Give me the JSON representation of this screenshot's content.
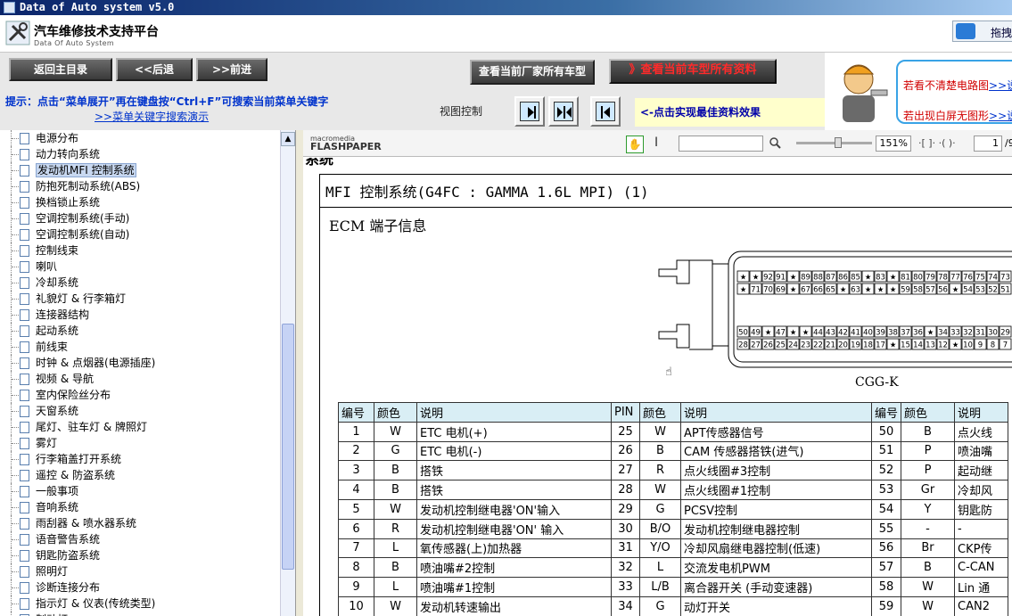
{
  "window": {
    "title": "Data of Auto system v5.0"
  },
  "logo": {
    "main": "汽车维修技术支持平台",
    "sub": "Data Of Auto System"
  },
  "search_widget": {
    "label": "拖拽"
  },
  "nav": {
    "home": "返回主目录",
    "back": "<<后退",
    "forward": ">>前进",
    "all_models": "查看当前厂家所有车型",
    "all_data": "》查看当前车型所有资料"
  },
  "hint": {
    "text": "提示：点击“菜单展开”再在键盘按“Ctrl+F”可搜索当前菜单关键字",
    "link": ">>菜单关键字搜索演示",
    "view_control": "视图控制",
    "best_effect": "<-点击实现最佳资料效果"
  },
  "notices": {
    "line1": "若看不清楚电路图",
    "line1_link": ">>说",
    "line2": "若出现白屏无图形",
    "line2_link": ">>说"
  },
  "sidebar": {
    "items": [
      "电源分布",
      "动力转向系统",
      "发动机MFI 控制系统",
      "防抱死制动系统(ABS)",
      "换档锁止系统",
      "空调控制系统(手动)",
      "空调控制系统(自动)",
      "控制线束",
      "喇叭",
      "冷却系统",
      "礼貌灯 & 行李箱灯",
      "连接器结构",
      "起动系统",
      "前线束",
      "时钟 & 点烟器(电源插座)",
      "视频 & 导航",
      "室内保险丝分布",
      "天窗系统",
      "尾灯、驻车灯 & 牌照灯",
      "雾灯",
      "行李箱盖打开系统",
      "遥控 & 防盗系统",
      "一般事项",
      "音响系统",
      "雨刮器 & 喷水器系统",
      "语音警告系统",
      "钥匙防盗系统",
      "照明灯",
      "诊断连接分布",
      "指示灯 & 仪表(传统类型)",
      "制动灯"
    ],
    "selected_index": 2
  },
  "viewer": {
    "brand_top": "macromedia",
    "brand_bottom": "FLASHPAPER",
    "zoom": "151%",
    "page": "1",
    "page_total": "/9"
  },
  "document": {
    "prev_tail": "系统",
    "title": "MFI 控制系统(G4FC : GAMMA 1.6L MPI) (1)",
    "heading": "ECM  端子信息",
    "connector_label": "CGG-K",
    "pins_row_top1": [
      "★",
      "★",
      "92",
      "91",
      "★",
      "89",
      "88",
      "87",
      "86",
      "85",
      "★",
      "83",
      "★",
      "81",
      "80",
      "79",
      "78",
      "77",
      "76",
      "75",
      "74",
      "73"
    ],
    "pins_row_top2": [
      "★",
      "71",
      "70",
      "69",
      "★",
      "67",
      "66",
      "65",
      "★",
      "63",
      "★",
      "★",
      "★",
      "59",
      "58",
      "57",
      "56",
      "★",
      "54",
      "53",
      "52",
      "51"
    ],
    "pins_row_bot1": [
      "50",
      "49",
      "★",
      "47",
      "★",
      "★",
      "44",
      "43",
      "42",
      "41",
      "40",
      "39",
      "38",
      "37",
      "36",
      "★",
      "34",
      "33",
      "32",
      "31",
      "30",
      "29"
    ],
    "pins_row_bot2": [
      "28",
      "27",
      "26",
      "25",
      "24",
      "23",
      "22",
      "21",
      "20",
      "19",
      "18",
      "17",
      "★",
      "15",
      "14",
      "13",
      "12",
      "★",
      "10",
      "9",
      "8",
      "7"
    ],
    "table_headers": [
      "编号",
      "颜色",
      "说明",
      "PIN",
      "颜色",
      "说明",
      "编号",
      "颜色",
      "说明"
    ],
    "table_rows": [
      [
        "1",
        "W",
        "ETC 电机(+)",
        "25",
        "W",
        "APT传感器信号",
        "50",
        "B",
        "点火线"
      ],
      [
        "2",
        "G",
        "ETC 电机(-)",
        "26",
        "B",
        "CAM 传感器搭铁(进气)",
        "51",
        "P",
        "喷油嘴"
      ],
      [
        "3",
        "B",
        "搭铁",
        "27",
        "R",
        "点火线圈#3控制",
        "52",
        "P",
        "起动继"
      ],
      [
        "4",
        "B",
        "搭铁",
        "28",
        "W",
        "点火线圈#1控制",
        "53",
        "Gr",
        "冷却风"
      ],
      [
        "5",
        "W",
        "发动机控制继电器'ON'输入",
        "29",
        "G",
        "PCSV控制",
        "54",
        "Y",
        "钥匙防"
      ],
      [
        "6",
        "R",
        "发动机控制继电器'ON' 输入",
        "30",
        "B/O",
        "发动机控制继电器控制",
        "55",
        "-",
        "-"
      ],
      [
        "7",
        "L",
        "氧传感器(上)加热器",
        "31",
        "Y/O",
        "冷却风扇继电器控制(低速)",
        "56",
        "Br",
        "CKP传"
      ],
      [
        "8",
        "B",
        "喷油嘴#2控制",
        "32",
        "L",
        "交流发电机PWM",
        "57",
        "B",
        "C-CAN"
      ],
      [
        "9",
        "L",
        "喷油嘴#1控制",
        "33",
        "L/B",
        "离合器开关 (手动变速器)",
        "58",
        "W",
        "Lin 通"
      ],
      [
        "10",
        "W",
        "发动机转速输出",
        "34",
        "G",
        "动灯开关",
        "59",
        "W",
        "CAN2"
      ]
    ]
  }
}
